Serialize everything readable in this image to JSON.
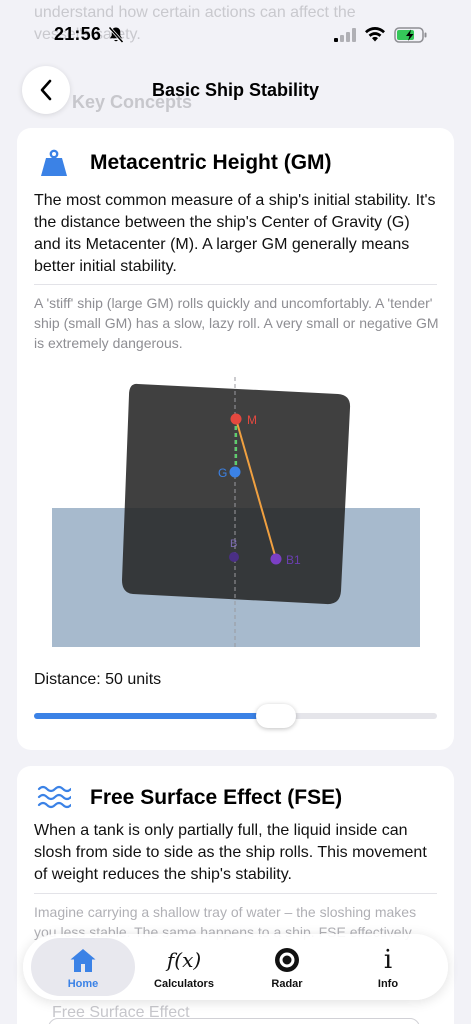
{
  "status": {
    "time": "21:56"
  },
  "ghost": {
    "top_line_1": "understand how certain actions can affect the",
    "top_line_2": "vessel's safety.",
    "section_heading": "Key Concepts",
    "bottom_heading": "Free Surface Effect"
  },
  "nav": {
    "title": "Basic Ship Stability",
    "back_icon": "chevron-left-icon"
  },
  "card_gm": {
    "icon": "weight-icon",
    "icon_color": "#3b82e6",
    "title": "Metacentric Height (GM)",
    "body": "The most common measure of a ship's initial stability. It's the distance between the ship's Center of Gravity (G) and its Metacenter (M). A larger GM generally means better initial stability.",
    "note": "A 'stiff' ship (large GM) rolls quickly and uncomfortably. A 'tender' ship (small GM) has a slow, lazy roll. A very small or negative GM is extremely dangerous.",
    "diagram": {
      "label_m": "M",
      "label_g": "G",
      "label_b": "B",
      "label_b1": "B1",
      "hull_color": "#2b2b2b",
      "water_color": "#8ea6bf",
      "m_color": "#e5483f",
      "g_color": "#3b82e6",
      "b_color": "#7b3fc4",
      "arm_color": "#f0a040",
      "gm_color": "#5ccf6b"
    },
    "distance_label": "Distance: 50 units",
    "slider_value": 0.6
  },
  "card_fse": {
    "icon": "waves-icon",
    "title": "Free Surface Effect (FSE)",
    "body": "When a tank is only partially full, the liquid inside can slosh from side to side as the ship rolls. This movement of weight reduces the ship's stability.",
    "note": "Imagine carrying a shallow tray of water – the sloshing makes you less stable. The same happens to a ship. FSE effectively"
  },
  "tabs": [
    {
      "label": "Home",
      "icon": "house-icon",
      "active": true
    },
    {
      "label": "Calculators",
      "icon": "function-icon",
      "glyph": "f(x)",
      "active": false
    },
    {
      "label": "Radar",
      "icon": "radar-icon",
      "active": false
    },
    {
      "label": "Info",
      "icon": "info-icon",
      "glyph": "i",
      "active": false
    }
  ]
}
